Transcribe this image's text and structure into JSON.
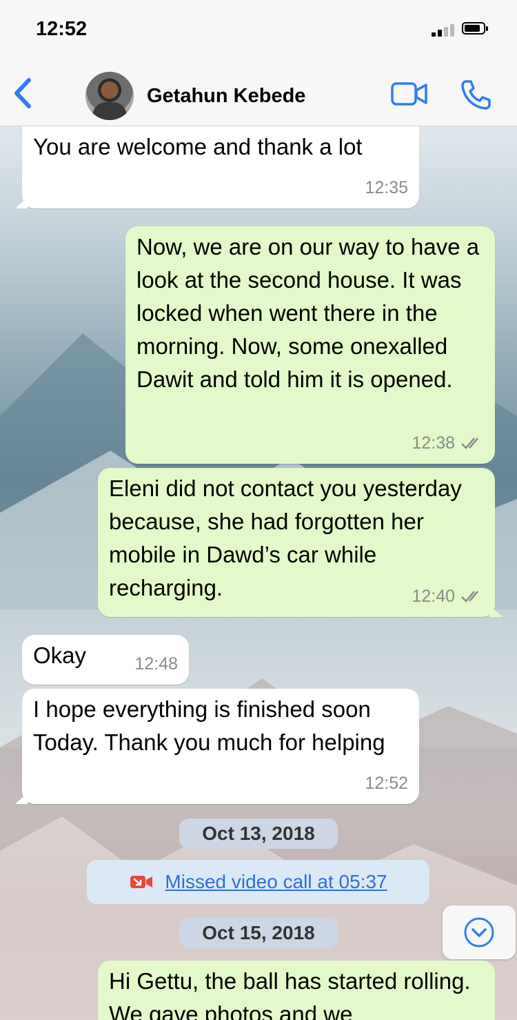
{
  "status_bar": {
    "time": "12:52"
  },
  "header": {
    "contact_name": "Getahun Kebede"
  },
  "messages": [
    {
      "direction": "in",
      "text": "You are welcome and thank a lot",
      "time": "12:35"
    },
    {
      "direction": "out",
      "text": "Now, we are on our way to have a look at the second house. It was locked when went there in the morning. Now, some onexalled Dawit and told him it is opened.",
      "time": "12:38"
    },
    {
      "direction": "out",
      "text": "Eleni did not contact you yesterday because, she had forgotten her mobile in Dawd’s car while recharging.",
      "time": "12:40"
    },
    {
      "direction": "in",
      "text": "Okay",
      "time": "12:48"
    },
    {
      "direction": "in",
      "text": "I hope everything is finished soon Today. Thank you much for helping",
      "time": "12:52"
    },
    {
      "direction": "out",
      "text": "Hi Gettu, the ball has started rolling. We gave photos and we",
      "time": ""
    }
  ],
  "dates": [
    "Oct 13, 2018",
    "Oct 15, 2018"
  ],
  "missed_call": {
    "text": "Missed video call at 05:37"
  },
  "colors": {
    "accent": "#2f7cf6",
    "outgoing_bubble": "#e3f9c9",
    "incoming_bubble": "#ffffff",
    "missed_icon": "#e5483e"
  }
}
